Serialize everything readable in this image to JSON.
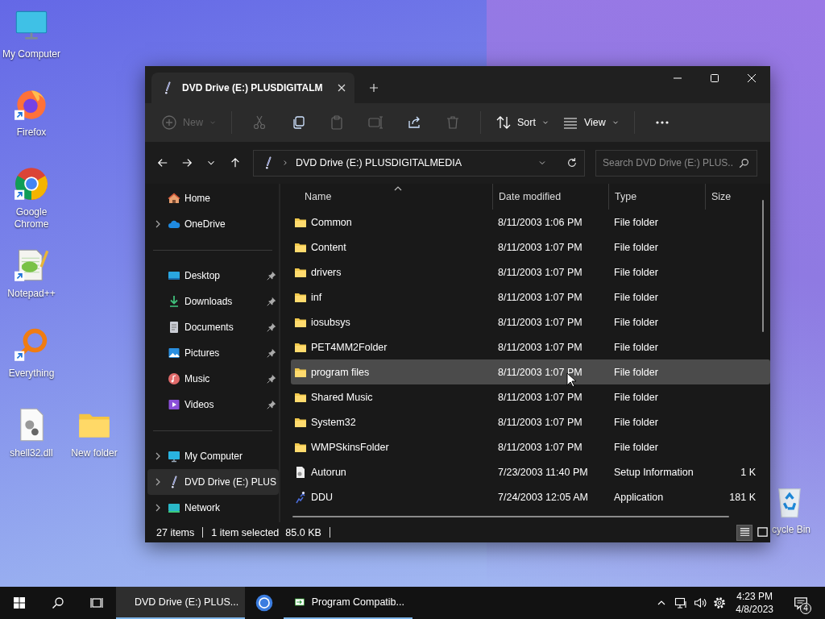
{
  "desktop": {
    "icons": [
      {
        "label": "My Computer",
        "kind": "monitor",
        "shortcut": false
      },
      {
        "label": "Firefox",
        "kind": "firefox",
        "shortcut": true
      },
      {
        "label": "Google Chrome",
        "kind": "chrome",
        "shortcut": true
      },
      {
        "label": "Notepad++",
        "kind": "notepad",
        "shortcut": true
      },
      {
        "label": "Everything",
        "kind": "everything",
        "shortcut": true
      },
      {
        "label": "shell32.dll",
        "kind": "dll",
        "shortcut": false
      },
      {
        "label": "New folder",
        "kind": "folder",
        "shortcut": false
      },
      {
        "label": "cycle Bin",
        "kind": "recycle",
        "shortcut": false
      }
    ]
  },
  "window": {
    "tabs": [
      {
        "title": "DVD Drive (E:) PLUSDIGITALM",
        "selected": true
      }
    ],
    "toolbar": [
      {
        "kind": "new",
        "label": "New",
        "disabled": true
      },
      {
        "kind": "separator"
      },
      {
        "kind": "cut",
        "disabled": true
      },
      {
        "kind": "copy",
        "disabled": false
      },
      {
        "kind": "paste",
        "disabled": true
      },
      {
        "kind": "rename",
        "disabled": true
      },
      {
        "kind": "share",
        "disabled": false
      },
      {
        "kind": "delete",
        "disabled": true
      },
      {
        "kind": "separator"
      },
      {
        "kind": "sort",
        "label": "Sort",
        "disabled": false
      },
      {
        "kind": "view",
        "label": "View",
        "disabled": false
      },
      {
        "kind": "separator"
      },
      {
        "kind": "more",
        "disabled": false
      }
    ],
    "address": {
      "path": "DVD Drive (E:) PLUSDIGITALMEDIA"
    },
    "search": {
      "placeholder": "Search DVD Drive (E:) PLUS..."
    },
    "sidebar": {
      "sections": [
        [
          {
            "label": "Home",
            "kind": "home",
            "pinned": false,
            "selected": false
          },
          {
            "label": "OneDrive",
            "kind": "cloud",
            "pinned": false,
            "expanded": false,
            "selected": false
          }
        ],
        [
          {
            "label": "Desktop",
            "kind": "desktop",
            "pinned": true,
            "selected": false
          },
          {
            "label": "Downloads",
            "kind": "downloads",
            "pinned": true,
            "selected": false
          },
          {
            "label": "Documents",
            "kind": "documents",
            "pinned": true,
            "selected": false
          },
          {
            "label": "Pictures",
            "kind": "pictures",
            "pinned": true,
            "selected": false
          },
          {
            "label": "Music",
            "kind": "music",
            "pinned": true,
            "selected": false
          },
          {
            "label": "Videos",
            "kind": "videos",
            "pinned": true,
            "selected": false
          }
        ],
        [
          {
            "label": "My Computer",
            "kind": "computer",
            "pinned": false,
            "expanded": false,
            "selected": false
          },
          {
            "label": "DVD Drive (E:) PLUS",
            "kind": "dvd",
            "pinned": false,
            "expanded": false,
            "selected": true
          },
          {
            "label": "Network",
            "kind": "network",
            "pinned": false,
            "expanded": false,
            "selected": false
          }
        ]
      ]
    },
    "columns": [
      {
        "label": "Name",
        "sorted": true
      },
      {
        "label": "Date modified",
        "sorted": false
      },
      {
        "label": "Type",
        "sorted": false
      },
      {
        "label": "Size",
        "sorted": false
      }
    ],
    "files": [
      {
        "name": "Common",
        "date": "8/11/2003 1:06 PM",
        "type": "File folder",
        "kind": "folder",
        "selected": false
      },
      {
        "name": "Content",
        "date": "8/11/2003 1:07 PM",
        "type": "File folder",
        "kind": "folder",
        "selected": false
      },
      {
        "name": "drivers",
        "date": "8/11/2003 1:07 PM",
        "type": "File folder",
        "kind": "folder",
        "selected": false
      },
      {
        "name": "inf",
        "date": "8/11/2003 1:07 PM",
        "type": "File folder",
        "kind": "folder",
        "selected": false
      },
      {
        "name": "iosubsys",
        "date": "8/11/2003 1:07 PM",
        "type": "File folder",
        "kind": "folder",
        "selected": false
      },
      {
        "name": "PET4MM2Folder",
        "date": "8/11/2003 1:07 PM",
        "type": "File folder",
        "kind": "folder",
        "selected": false
      },
      {
        "name": "program files",
        "date": "8/11/2003 1:07 PM",
        "type": "File folder",
        "kind": "folder",
        "selected": true
      },
      {
        "name": "Shared Music",
        "date": "8/11/2003 1:07 PM",
        "type": "File folder",
        "kind": "folder",
        "selected": false
      },
      {
        "name": "System32",
        "date": "8/11/2003 1:07 PM",
        "type": "File folder",
        "kind": "folder",
        "selected": false
      },
      {
        "name": "WMPSkinsFolder",
        "date": "8/11/2003 1:07 PM",
        "type": "File folder",
        "kind": "folder",
        "selected": false
      },
      {
        "name": "Autorun",
        "date": "7/23/2003 11:40 PM",
        "type": "Setup Information",
        "size": "1 K",
        "kind": "setup",
        "selected": false
      },
      {
        "name": "DDU",
        "date": "7/24/2003 12:05 AM",
        "type": "Application",
        "size": "181 K",
        "kind": "app",
        "selected": false
      }
    ],
    "status": {
      "count": "27 items",
      "selection": "1 item selected",
      "selection_size": "85.0 KB"
    },
    "view_modes": [
      {
        "kind": "details",
        "selected": true
      },
      {
        "kind": "tiles",
        "selected": false
      }
    ]
  },
  "taskbar": {
    "apps": [
      {
        "kind": "explorer",
        "label": "DVD Drive (E:) PLUS...",
        "active": true,
        "running": true
      },
      {
        "kind": "browser",
        "active": false,
        "running": false
      },
      {
        "kind": "compat",
        "label": "Program Compatib...",
        "active": false,
        "running": true
      }
    ],
    "tray": {
      "time": "4:23 PM",
      "date": "4/8/2023",
      "notifications": "4"
    }
  }
}
